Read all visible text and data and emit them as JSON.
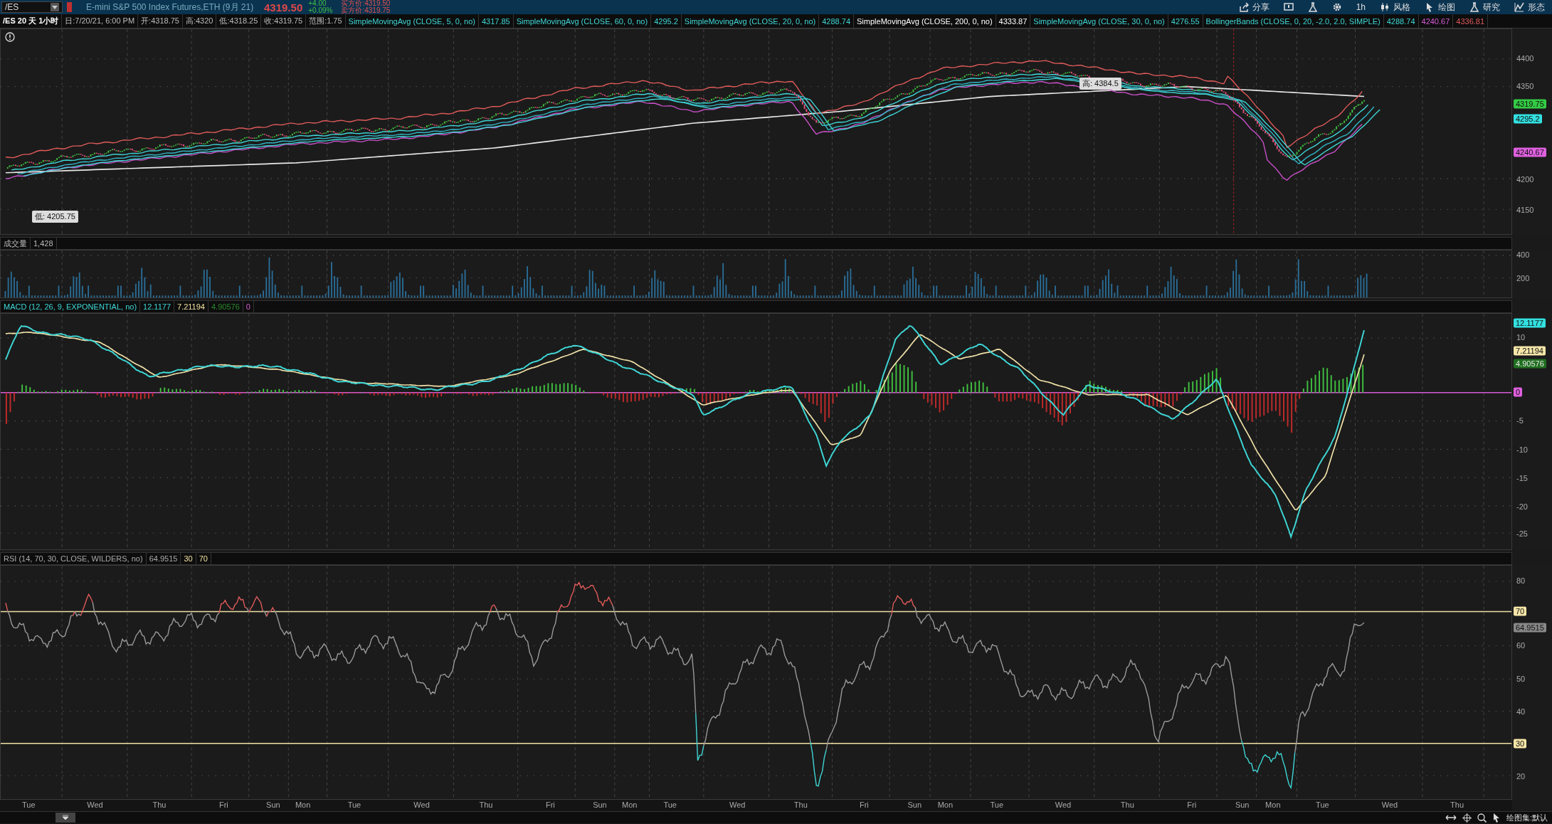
{
  "toolbar": {
    "symbol": "/ES",
    "description": "E-mini S&P 500 Index Futures,ETH (9月 21)",
    "last_price": "4319.50",
    "change": "+4.00",
    "change_percent": "+0.09%",
    "bid": "买方价:4319.50",
    "ask": "卖方价:4319.75",
    "buttons": [
      {
        "kind": "share",
        "label": "分享"
      },
      {
        "kind": "message"
      },
      {
        "kind": "flask"
      },
      {
        "kind": "gear"
      },
      {
        "kind": "timeframe",
        "label": "1h"
      },
      {
        "kind": "style",
        "label": "风格"
      },
      {
        "kind": "draw",
        "label": "绘图"
      },
      {
        "kind": "study",
        "label": "研究"
      },
      {
        "kind": "pattern",
        "label": "形态"
      }
    ]
  },
  "legend": [
    {
      "text": "/ES 20 天 1小时",
      "kind": "title"
    },
    {
      "text": "日:7/20/21, 6:00 PM",
      "kind": "quote"
    },
    {
      "text": "开:4318.75",
      "kind": "quote"
    },
    {
      "text": "高:4320",
      "kind": "quote"
    },
    {
      "text": "低:4318.25",
      "kind": "quote"
    },
    {
      "text": "收:4319.75",
      "kind": "quote"
    },
    {
      "text": "范围:1.75",
      "kind": "quote"
    },
    {
      "text": "SimpleMovingAvg (CLOSE, 5, 0, no)",
      "kind": "study"
    },
    {
      "text": "4317.85",
      "kind": "study"
    },
    {
      "text": "SimpleMovingAvg (CLOSE, 60, 0, no)",
      "kind": "study"
    },
    {
      "text": "4295.2",
      "kind": "study"
    },
    {
      "text": "SimpleMovingAvg (CLOSE, 20, 0, no)",
      "kind": "study"
    },
    {
      "text": "4288.74",
      "kind": "study"
    },
    {
      "text": "SimpleMovingAvg (CLOSE, 200, 0, no)",
      "kind": "longterm"
    },
    {
      "text": "4333.87",
      "kind": "longterm"
    },
    {
      "text": "SimpleMovingAvg (CLOSE, 30, 0, no)",
      "kind": "study"
    },
    {
      "text": "4276.55",
      "kind": "study"
    },
    {
      "text": "BollingerBands (CLOSE, 0, 20, -2.0, 2.0, SIMPLE)",
      "kind": "study"
    },
    {
      "text": "4288.74",
      "kind": "study"
    },
    {
      "text": "4240.67",
      "kind": "lowerband"
    },
    {
      "text": "4336.81",
      "kind": "upperband"
    }
  ],
  "price_pane": {
    "axis_labels": [
      "4400",
      "4350",
      "4200",
      "4150"
    ],
    "badges": [
      {
        "text": "4319.75",
        "color": "#33cc44"
      },
      {
        "text": "4295.2",
        "color": "#33e0e0"
      },
      {
        "text": "4240.67",
        "color": "#e060e0"
      }
    ],
    "high_callout": "高: 4384.5",
    "low_callout": "低: 4205.75"
  },
  "volume_pane": {
    "title": "成交量",
    "value": "1,428",
    "axis_labels": [
      "400",
      "200"
    ]
  },
  "macd_pane": {
    "legend": [
      {
        "text": "MACD (12, 26, 9, EXPONENTIAL, no)",
        "kind": "macd"
      },
      {
        "text": "12.1177",
        "kind": "macd"
      },
      {
        "text": "7.21194",
        "kind": "signal"
      },
      {
        "text": "4.90576",
        "kind": "histogram"
      },
      {
        "text": "0",
        "kind": "zero"
      }
    ],
    "axis_labels": [
      "10",
      "-5",
      "-10",
      "-15",
      "-20",
      "-25"
    ],
    "badges": [
      {
        "text": "12.1177",
        "color": "#33e0e0"
      },
      {
        "text": "7.21194",
        "color": "#f5e6a8"
      },
      {
        "text": "4.90576",
        "color": "#1f6e1f"
      },
      {
        "text": "0",
        "color": "#e060e0"
      }
    ]
  },
  "rsi_pane": {
    "legend": [
      {
        "text": "RSI (14, 70, 30, CLOSE, WILDERS, no)",
        "kind": "rsi"
      },
      {
        "text": "64.9515",
        "kind": "rsi"
      },
      {
        "text": "30",
        "kind": "level"
      },
      {
        "text": "70",
        "kind": "level"
      }
    ],
    "axis_labels": [
      "80",
      "60",
      "50",
      "40",
      "20"
    ],
    "badges": [
      {
        "text": "70",
        "color": "#f5e6a8"
      },
      {
        "text": "64.9515",
        "color": "#888888"
      },
      {
        "text": "30",
        "color": "#f5e6a8"
      }
    ]
  },
  "time_axis": [
    "Tue",
    "Wed",
    "Thu",
    "Fri",
    "Sun",
    "Mon",
    "Tue",
    "Wed",
    "Thu",
    "Fri",
    "Sun",
    "Mon",
    "Tue",
    "Wed",
    "Thu",
    "Fri",
    "Sun",
    "Mon",
    "Tue",
    "Wed",
    "Thu",
    "Fri",
    "Sun",
    "Mon",
    "Tue",
    "Wed",
    "Thu"
  ],
  "bottom_bar": {
    "drawing_set": "绘图集:默认"
  }
}
